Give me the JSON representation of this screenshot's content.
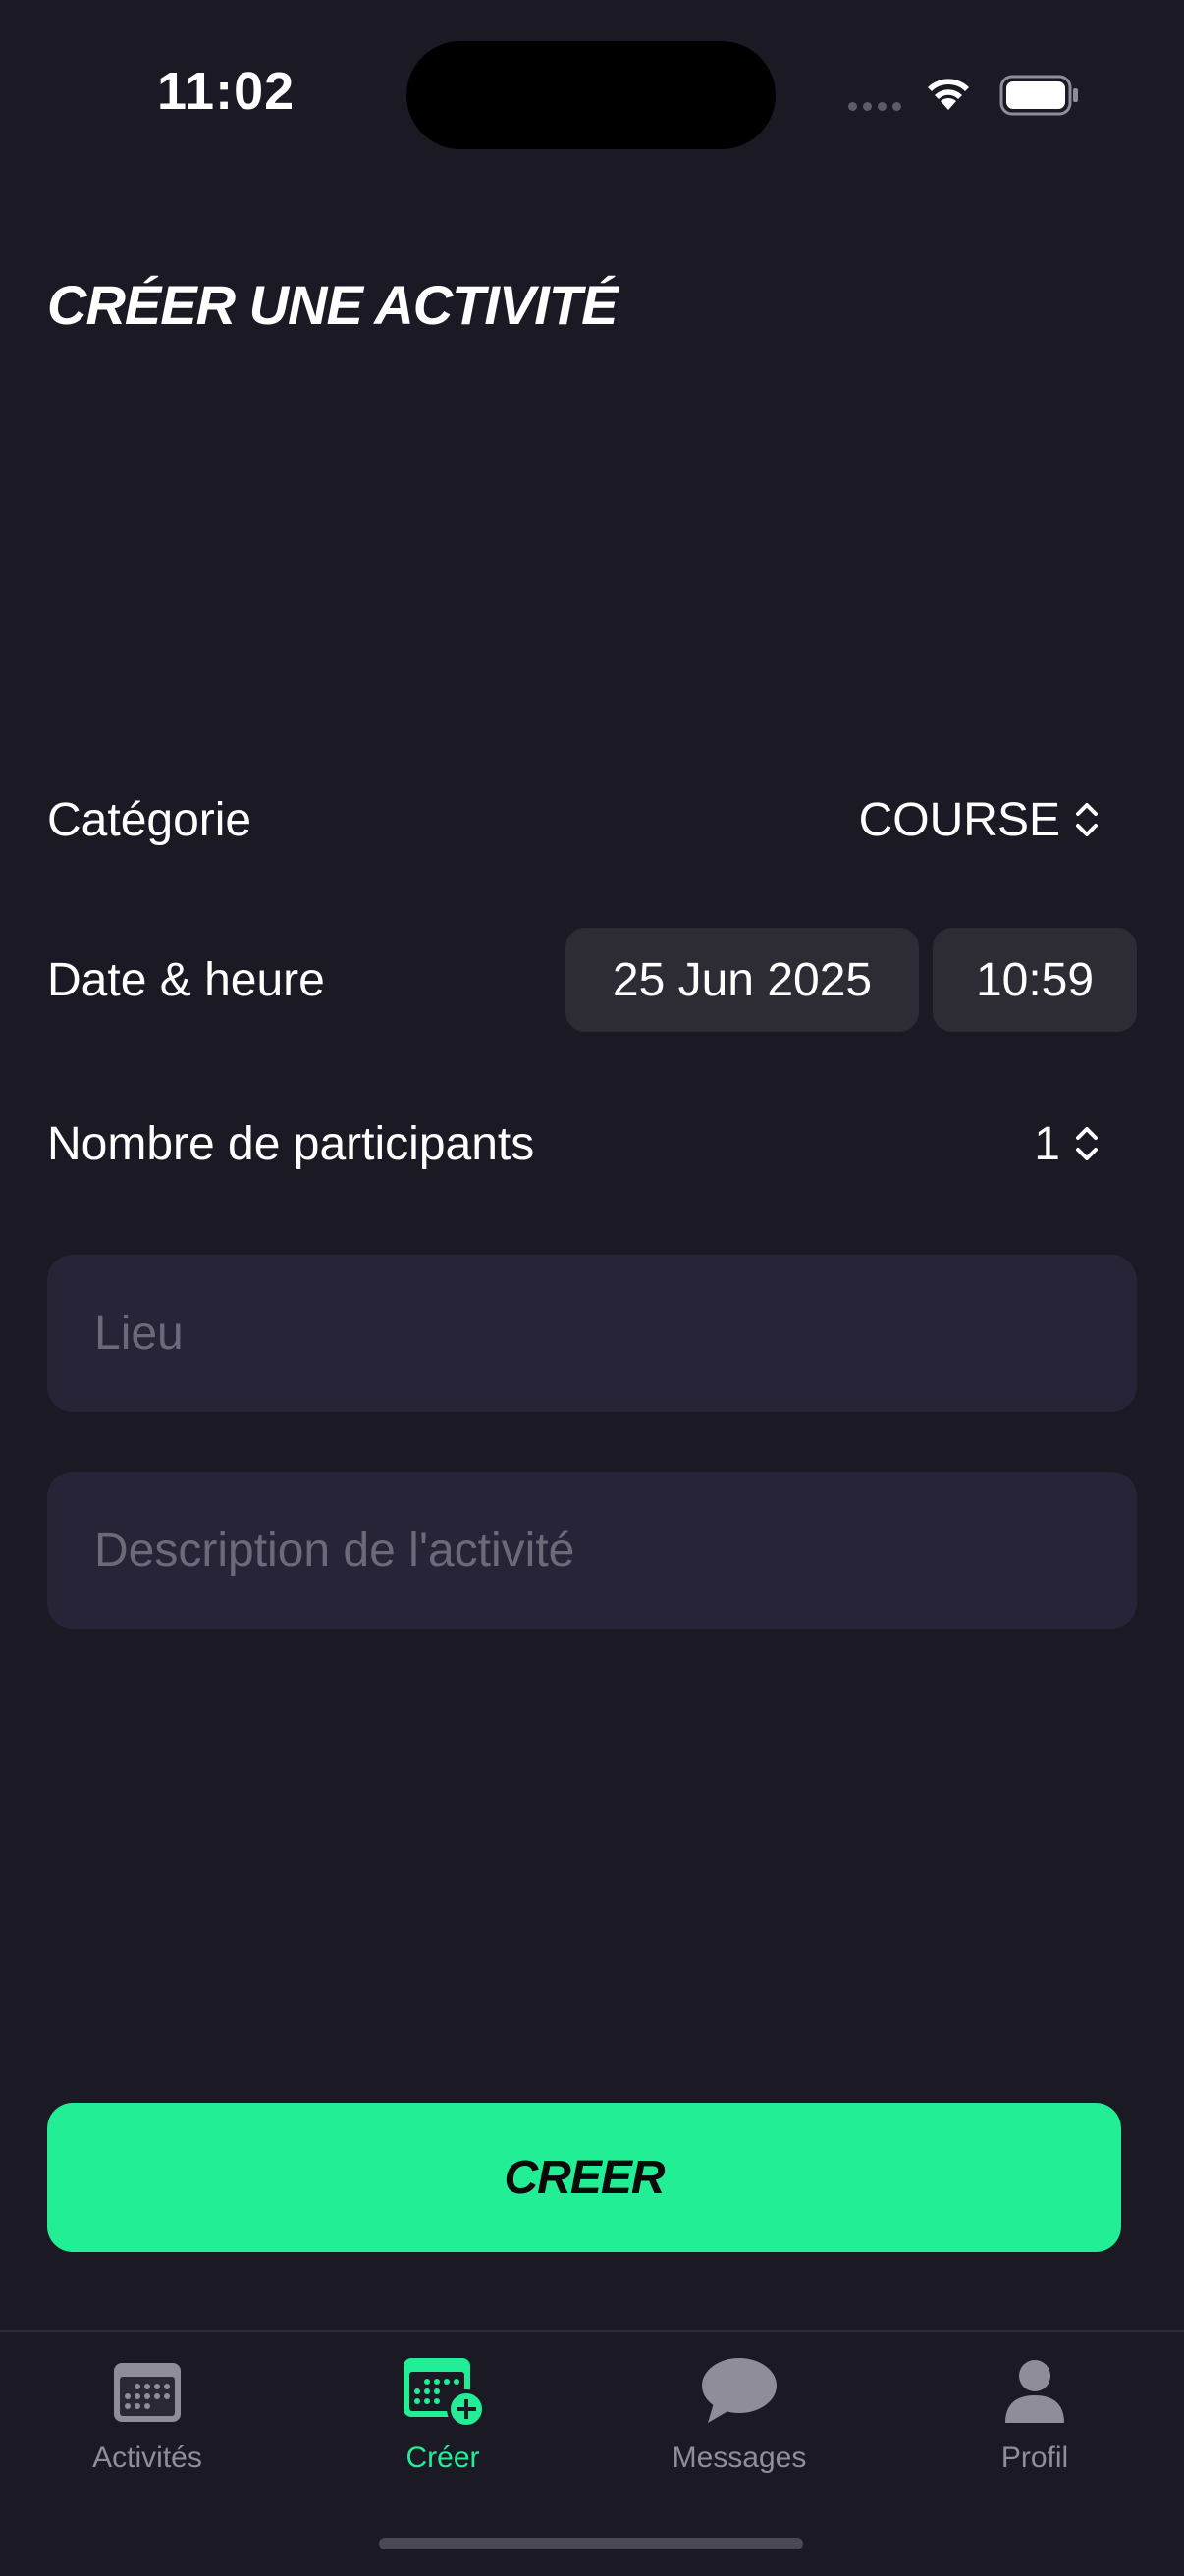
{
  "status_bar": {
    "time": "11:02"
  },
  "header": {
    "title": "CRÉER UNE ACTIVITÉ"
  },
  "form": {
    "category": {
      "label": "Catégorie",
      "value": "COURSE"
    },
    "datetime": {
      "label": "Date & heure",
      "date": "25 Jun 2025",
      "time": "10:59"
    },
    "participants": {
      "label": "Nombre de participants",
      "value": "1"
    },
    "location": {
      "placeholder": "Lieu",
      "value": ""
    },
    "description": {
      "placeholder": "Description de l'activité",
      "value": ""
    }
  },
  "submit": {
    "label": "CREER"
  },
  "tab_bar": {
    "tabs": [
      {
        "label": "Activités",
        "icon": "calendar-icon",
        "active": false
      },
      {
        "label": "Créer",
        "icon": "calendar-add-icon",
        "active": true
      },
      {
        "label": "Messages",
        "icon": "chat-bubble-icon",
        "active": false
      },
      {
        "label": "Profil",
        "icon": "person-icon",
        "active": false
      }
    ]
  },
  "colors": {
    "background": "#1b1923",
    "accent": "#22ee96",
    "field_background": "#262436",
    "chip_background": "#2d2c35",
    "inactive_tab": "#8f8d98"
  }
}
